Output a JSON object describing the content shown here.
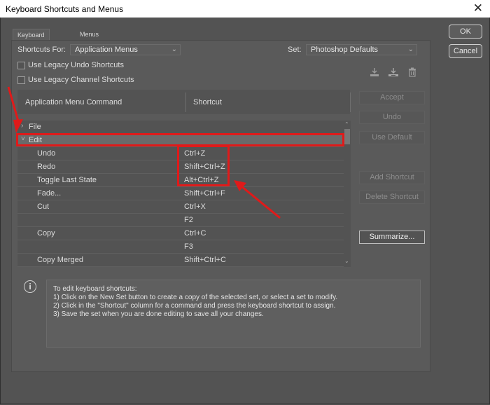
{
  "window": {
    "title": "Keyboard Shortcuts and Menus",
    "close_glyph": "✕"
  },
  "tabs": [
    {
      "label": "Keyboard Shortcuts"
    },
    {
      "label": "Menus"
    }
  ],
  "shortcuts_for": {
    "label": "Shortcuts For:",
    "value": "Application Menus"
  },
  "set": {
    "label": "Set:",
    "value": "Photoshop Defaults"
  },
  "checkboxes": [
    {
      "label": "Use Legacy Undo Shortcuts",
      "checked": false
    },
    {
      "label": "Use Legacy Channel Shortcuts",
      "checked": false
    }
  ],
  "set_icons": [
    "save-set-icon",
    "new-set-icon",
    "delete-set-icon"
  ],
  "table": {
    "col_command": "Application Menu Command",
    "col_shortcut": "Shortcut",
    "rows": [
      {
        "type": "group",
        "arrow": "›",
        "command": "File",
        "shortcut": ""
      },
      {
        "type": "group",
        "arrow": "˅",
        "command": "Edit",
        "shortcut": ""
      },
      {
        "type": "item",
        "command": "Undo",
        "shortcut": "Ctrl+Z"
      },
      {
        "type": "item",
        "command": "Redo",
        "shortcut": "Shift+Ctrl+Z"
      },
      {
        "type": "item",
        "command": "Toggle Last State",
        "shortcut": "Alt+Ctrl+Z"
      },
      {
        "type": "item",
        "command": "Fade...",
        "shortcut": "Shift+Ctrl+F"
      },
      {
        "type": "item",
        "command": "Cut",
        "shortcut": "Ctrl+X"
      },
      {
        "type": "item",
        "command": "",
        "shortcut": "F2"
      },
      {
        "type": "item",
        "command": "Copy",
        "shortcut": "Ctrl+C"
      },
      {
        "type": "item",
        "command": "",
        "shortcut": "F3"
      },
      {
        "type": "item",
        "command": "Copy Merged",
        "shortcut": "Shift+Ctrl+C"
      }
    ]
  },
  "buttons": {
    "ok": "OK",
    "cancel": "Cancel",
    "accept": "Accept",
    "undo": "Undo",
    "use_default": "Use Default",
    "add_shortcut": "Add Shortcut",
    "delete_shortcut": "Delete Shortcut",
    "summarize": "Summarize..."
  },
  "info": {
    "icon": "i",
    "lines": [
      "To edit keyboard shortcuts:",
      "1) Click on the New Set button to create a copy of the selected set, or select a set to modify.",
      "2) Click in the \"Shortcut\" column for a command and press the keyboard shortcut to assign.",
      "3) Save the set when you are done editing to save all your changes."
    ]
  },
  "colors": {
    "annotation_red": "#e01a1a",
    "dialog_bg": "#535353"
  }
}
